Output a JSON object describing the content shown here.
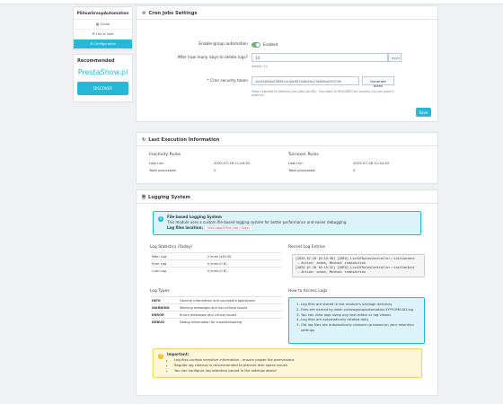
{
  "sidebar": {
    "title": "PShowGroupAutomation",
    "items": [
      {
        "label": "Guide",
        "icon": "book-icon"
      },
      {
        "label": "List of Sold",
        "icon": "list-icon"
      },
      {
        "label": "Configuration",
        "icon": "cogs-icon",
        "active": true
      }
    ],
    "recommended_title": "Recommended",
    "logo_text": "PrestaShow.pl",
    "discover_label": "DISCOVER"
  },
  "cron": {
    "title": "Cron Jobs Settings",
    "enable_label": "Enable group automation",
    "enable_state": "Enabled",
    "days_label": "After how many days to delete logs?",
    "days_value": "14",
    "days_addon": "days",
    "days_help": "default: 14",
    "token_label": "* Cron security token",
    "token_value": "2b2d3483be678f85c1a7bd4f612d8d2fe275e6d94e5537169",
    "generate_label": "Generate token",
    "token_help": "Token required to execute cron jobs via URL. The token is REQUIRED for security. Do not share it publicly!",
    "save_label": "Save"
  },
  "execution": {
    "title": "Last Execution Information",
    "inactivity": {
      "heading": "Inactivity Rules",
      "last_run_label": "Last run:",
      "last_run_value": "2025-07-28 11:44:52",
      "processed_label": "Total processed:",
      "processed_value": "0"
    },
    "turnover": {
      "heading": "Turnover Rules",
      "last_run_label": "Last run:",
      "last_run_value": "2025-07-28 11:44:52",
      "processed_label": "Total processed:",
      "processed_value": "0"
    }
  },
  "logging": {
    "title": "Logging System",
    "info_title": "File-based Logging System",
    "info_text": "This module uses a custom file-based logging system for better performance and easier debugging.",
    "location_label": "Log files location:",
    "location_value": "/var/www/html/var/logs/",
    "stats_title": "Log Statistics (Today)",
    "stats": [
      {
        "name": "Main Log",
        "value": "2 lines (452 B)"
      },
      {
        "name": "Error Log",
        "value": "0 lines (0 B)"
      },
      {
        "name": "Cron Log",
        "value": "0 lines (0 B)"
      }
    ],
    "recent_title": "Recent Log Entries",
    "recent_text": "[2025-07-28 10:15:38] [INFO] ListOfRulesController::initContent\n - Action: index, Method: indexAction\n[2025-07-28 10:15:32] [INFO] ListOfRulesController::initContent\n - Action: index, Method: indexAction",
    "types_title": "Log Types",
    "types": [
      {
        "name": "INFO",
        "desc": "General information and successful operations"
      },
      {
        "name": "WARNING",
        "desc": "Warning messages and non-critical issues"
      },
      {
        "name": "ERROR",
        "desc": "Errors messages and critical issues"
      },
      {
        "name": "DEBUG",
        "desc": "Debug information for troubleshooting"
      }
    ],
    "access_title": "How to Access Logs",
    "access_steps": [
      "Log files are stored in the module's var/logs directory",
      "Files are named by date: pshowgroupautomation-YYYY-MM-DD.log",
      "You can view logs using any text editor or log viewer",
      "Log files are automatically rotated daily",
      "Old log files are automatically cleaned up based on your retention settings"
    ],
    "important_title": "Important:",
    "important_items": [
      "Log files contain sensitive information - ensure proper file permissions",
      "Regular log cleanup is recommended to prevent disk space issues",
      "You can configure log retention period in the settings above"
    ]
  },
  "colors": {
    "accent": "#25b9d7",
    "success": "#70b580",
    "warning": "#f2b827"
  }
}
